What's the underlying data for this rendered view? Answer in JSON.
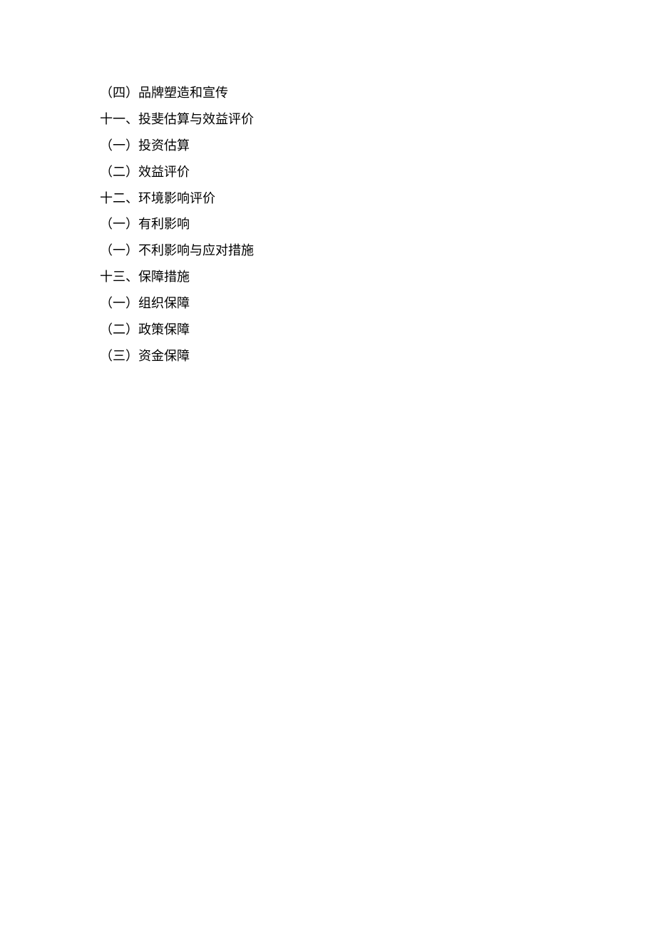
{
  "lines": [
    "（四）品牌塑造和宣传",
    "十一、投斐估算与效益评价",
    "（一）投资估算",
    "（二）效益评价",
    "十二、环境影响评价",
    "（一）有利影响",
    "（一）不利影响与应对措施",
    "十三、保障措施",
    "（一）组织保障",
    "（二）政策保障",
    "（三）资金保障"
  ]
}
